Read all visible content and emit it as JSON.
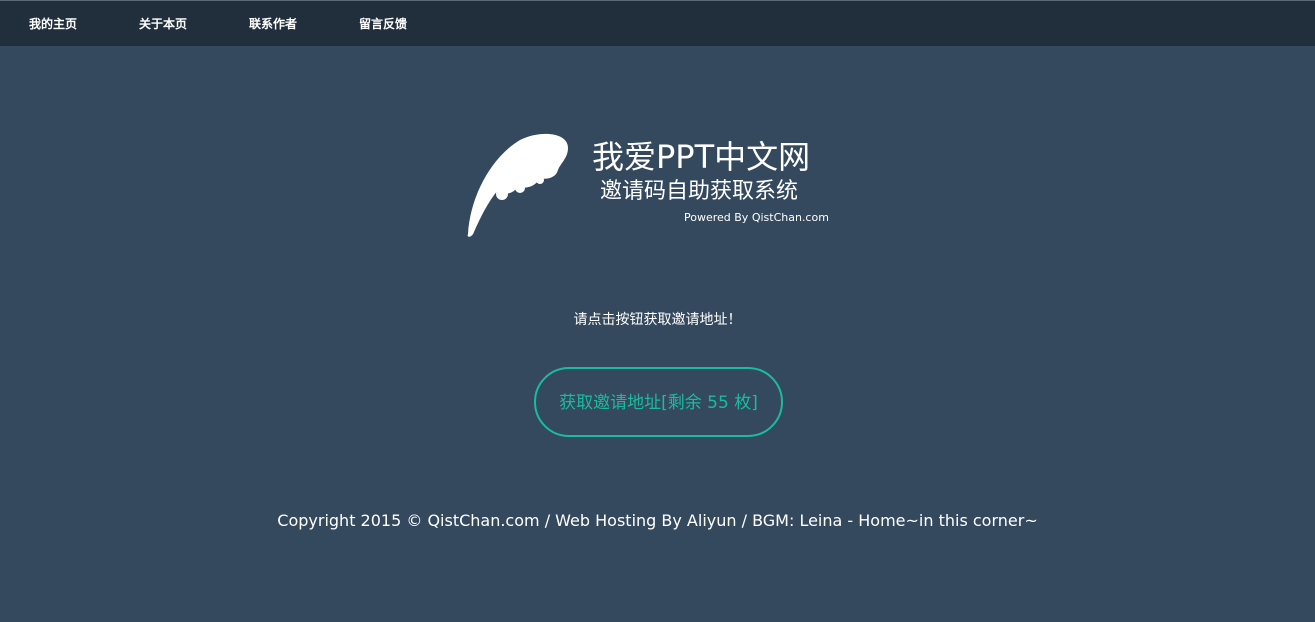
{
  "nav": {
    "items": [
      {
        "label": "我的主页"
      },
      {
        "label": "关于本页"
      },
      {
        "label": "联系作者"
      },
      {
        "label": "留言反馈"
      }
    ]
  },
  "logo": {
    "icon": "feather-icon",
    "title": "我爱PPT中文网",
    "subtitle": "邀请码自助获取系统",
    "powered_by": "Powered By QistChan.com"
  },
  "main": {
    "prompt": "请点击按钮获取邀请地址！",
    "button_label": "获取邀请地址[剩余 55 枚]"
  },
  "footer": {
    "text": "Copyright 2015 © QistChan.com / Web Hosting By Aliyun / BGM: Leina - Home~in this corner~"
  },
  "colors": {
    "background": "#34495e",
    "navbar": "#212f3d",
    "accent": "#1abc9c",
    "text": "#ffffff"
  }
}
